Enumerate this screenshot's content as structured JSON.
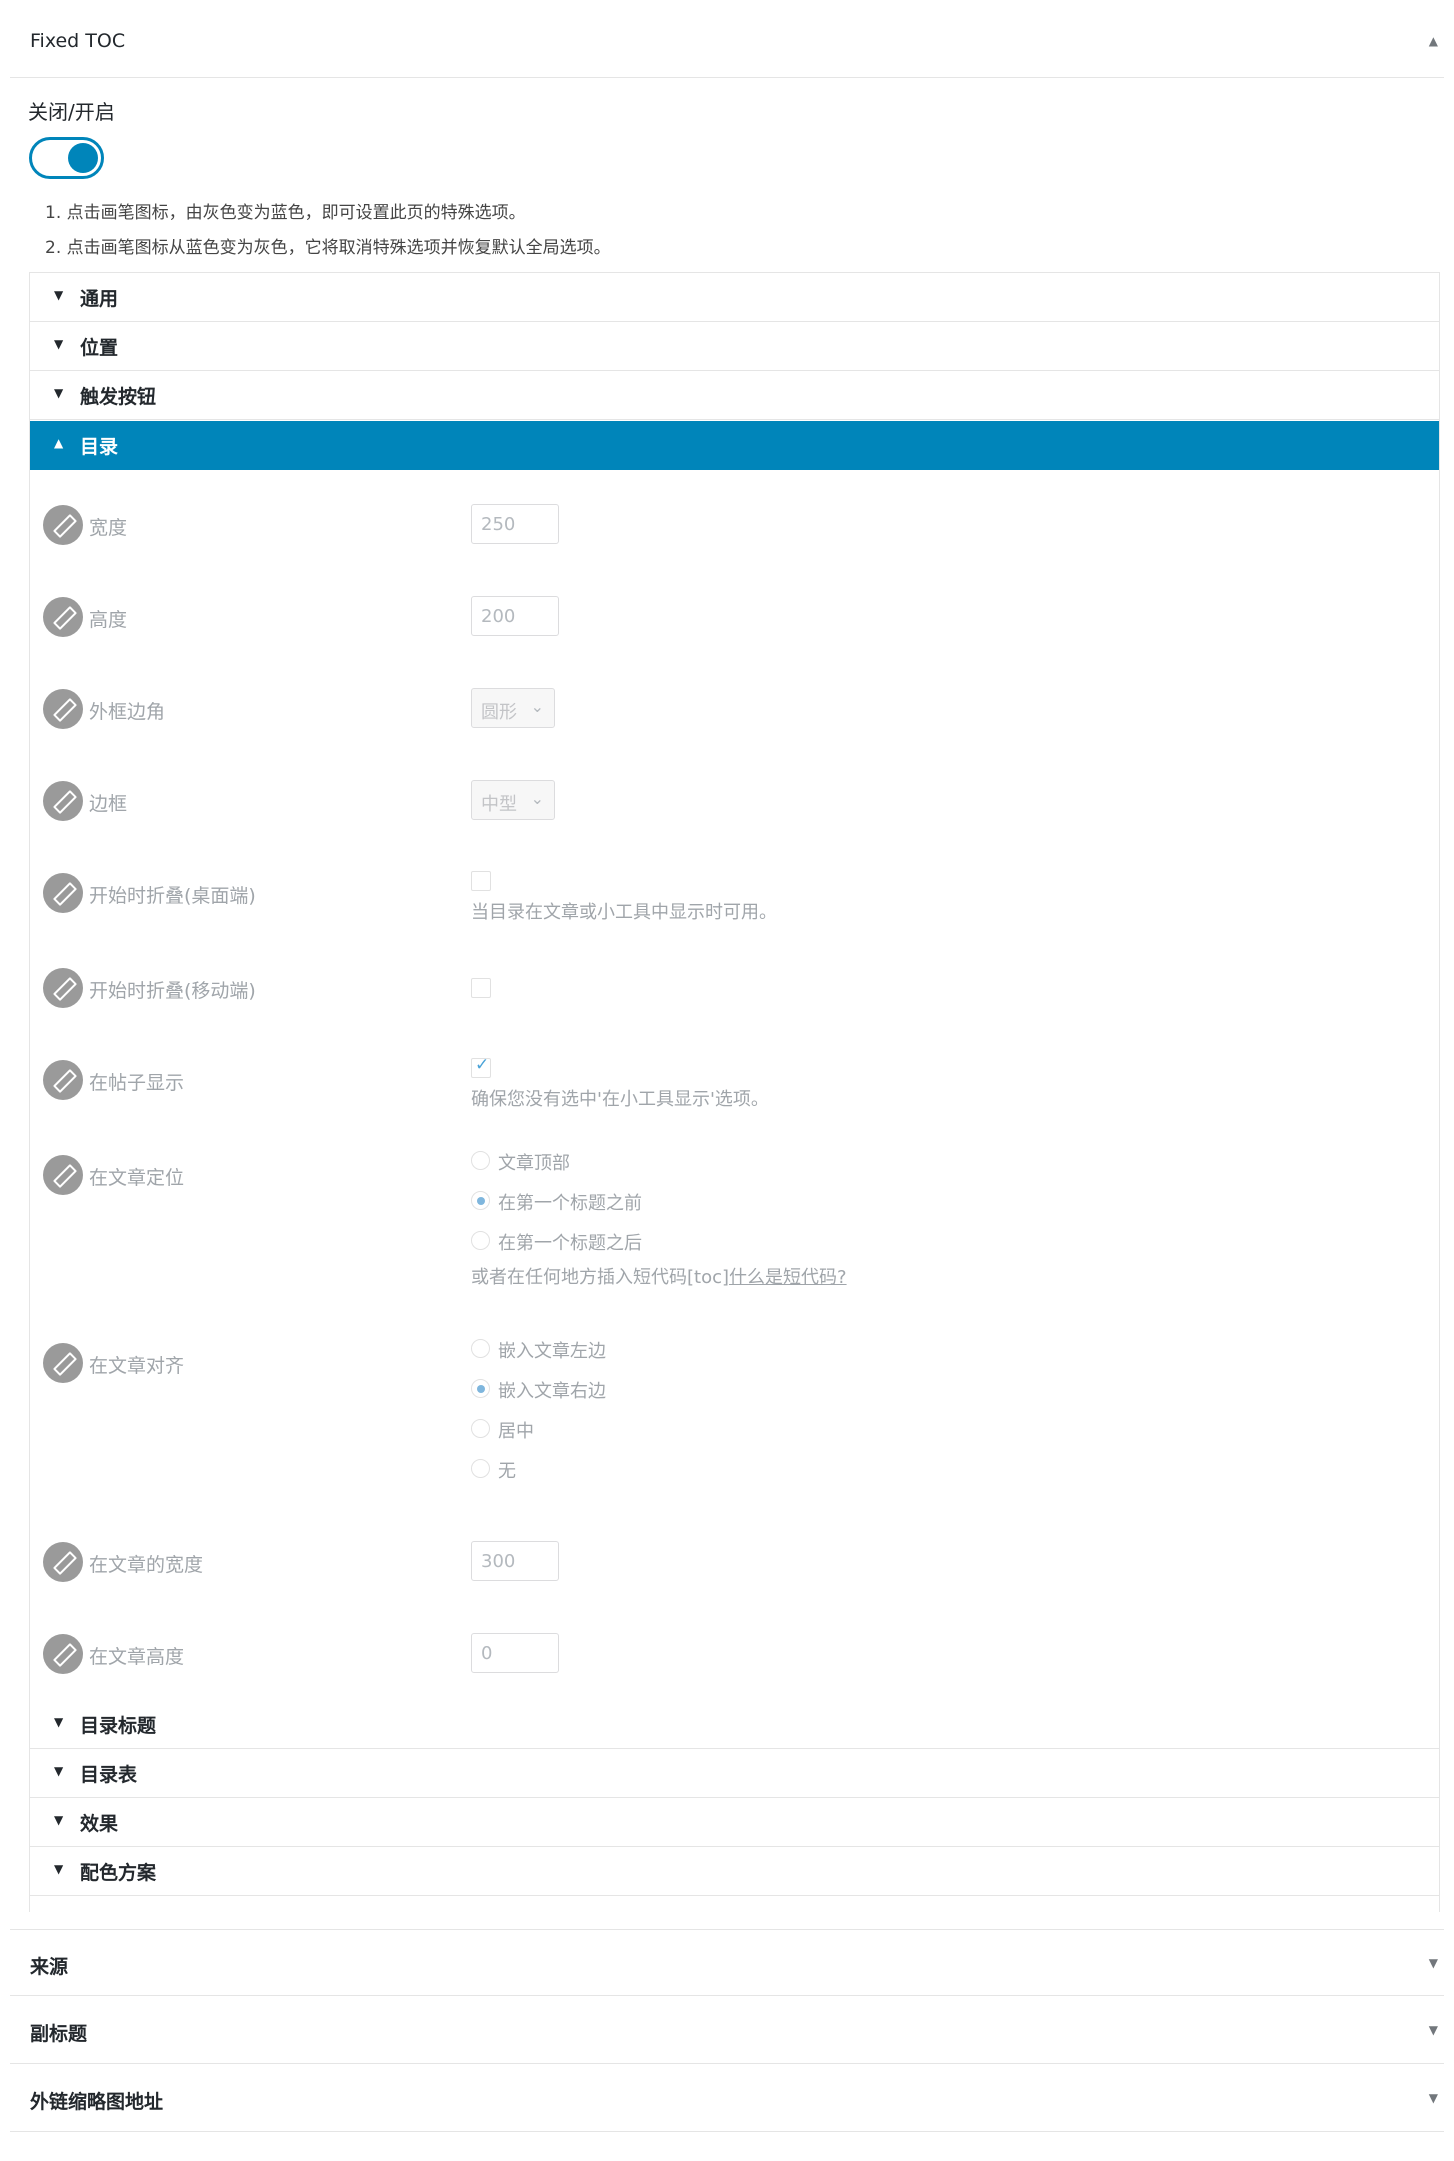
{
  "metabox": {
    "title": "Fixed TOC",
    "collapse_icon": "triangle-up-icon"
  },
  "toggle": {
    "label": "关闭/开启",
    "state": "on"
  },
  "notes": [
    "1. 点击画笔图标，由灰色变为蓝色，即可设置此页的特殊选项。",
    "2. 点击画笔图标从蓝色变为灰色，它将取消特殊选项并恢复默认全局选项。"
  ],
  "sections": {
    "general": "通用",
    "position": "位置",
    "trigger": "触发按钮",
    "contents": "目录",
    "contents_title": "目录标题",
    "contents_list": "目录表",
    "effects": "效果",
    "color_scheme": "配色方案"
  },
  "fields": {
    "width": {
      "label": "宽度",
      "value": "250"
    },
    "height": {
      "label": "高度",
      "value": "200"
    },
    "border_radius": {
      "label": "外框边角",
      "selected": "圆形"
    },
    "border": {
      "label": "边框",
      "selected": "中型"
    },
    "collapse_desktop": {
      "label": "开始时折叠(桌面端)",
      "checked": false,
      "help": "当目录在文章或小工具中显示时可用。"
    },
    "collapse_mobile": {
      "label": "开始时折叠(移动端)",
      "checked": false
    },
    "show_in_post": {
      "label": "在帖子显示",
      "checked": true,
      "help": "确保您没有选中'在小工具显示'选项。"
    },
    "post_position": {
      "label": "在文章定位",
      "options": [
        "文章顶部",
        "在第一个标题之前",
        "在第一个标题之后"
      ],
      "selected": "在第一个标题之前",
      "help": "或者在任何地方插入短代码[toc]",
      "help_link": "什么是短代码?"
    },
    "post_align": {
      "label": "在文章对齐",
      "options": [
        "嵌入文章左边",
        "嵌入文章右边",
        "居中",
        "无"
      ],
      "selected": "嵌入文章右边"
    },
    "post_width": {
      "label": "在文章的宽度",
      "value": "300"
    },
    "post_height": {
      "label": "在文章高度",
      "value": "0"
    }
  },
  "outer_boxes": {
    "source": "来源",
    "subtitle": "副标题",
    "thumb_url": "外链缩略图地址"
  },
  "colors": {
    "accent": "#0085ba",
    "pen_icon_bg": "#9a9a9a"
  },
  "icons": {
    "expand": "triangle-down-icon",
    "collapse": "triangle-up-icon",
    "pen": "pencil-icon",
    "select": "chevron-down-icon"
  }
}
